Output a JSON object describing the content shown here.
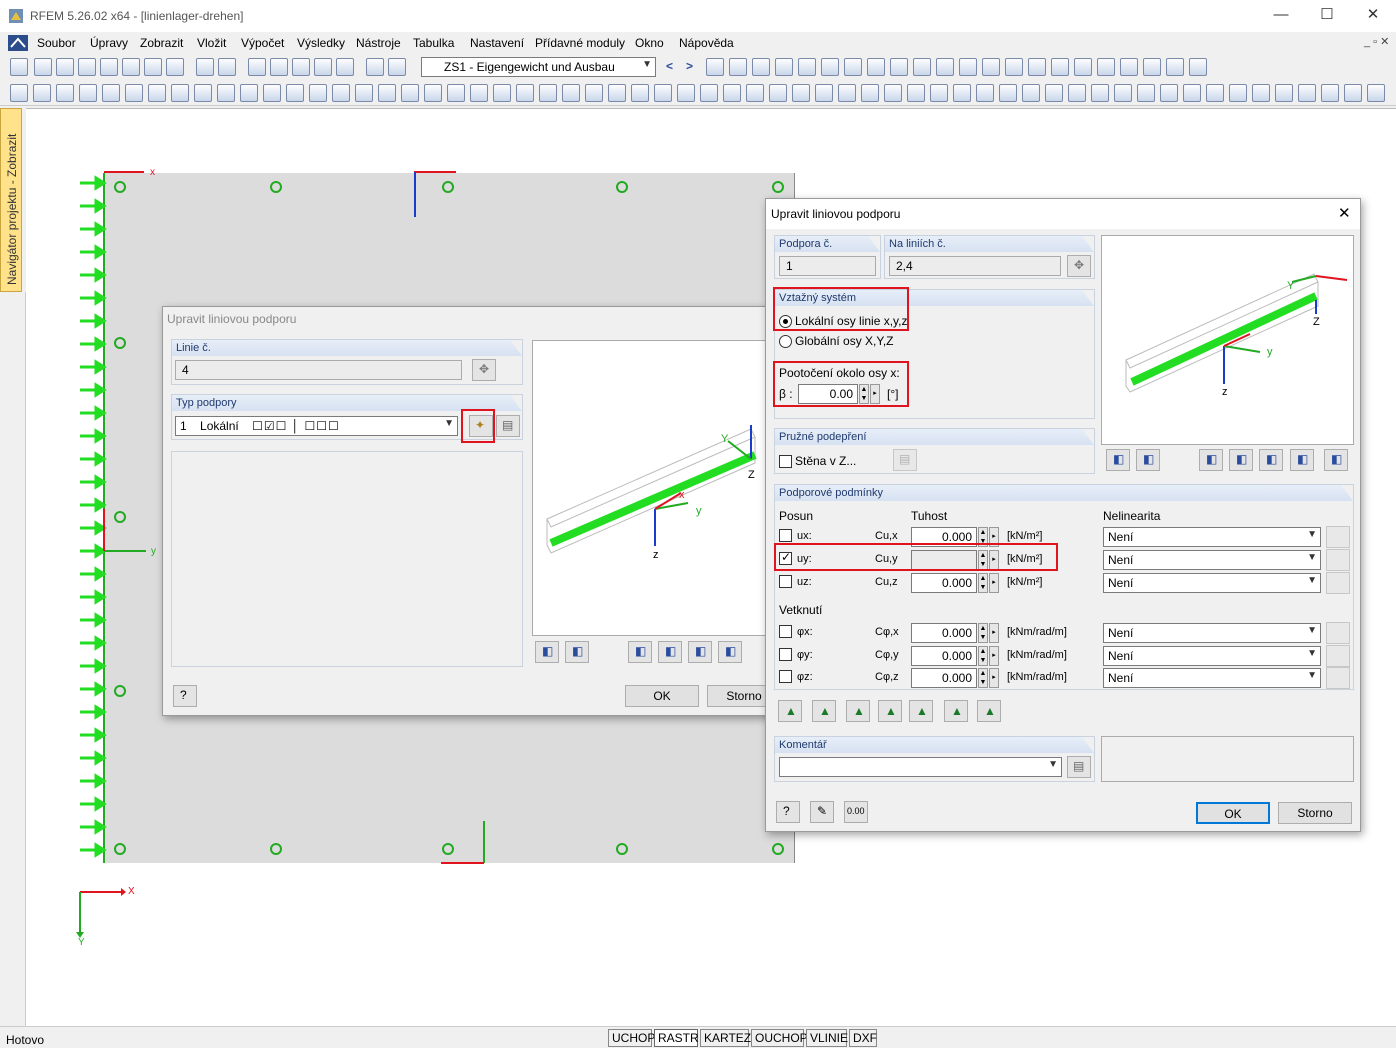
{
  "app": {
    "title": "RFEM 5.26.02 x64 - [linienlager-drehen]",
    "window_min": "—",
    "window_max": "☐",
    "window_close": "✕"
  },
  "menu": [
    "Soubor",
    "Úpravy",
    "Zobrazit",
    "Vložit",
    "Výpočet",
    "Výsledky",
    "Nástroje",
    "Tabulka",
    "Nastavení",
    "Přídavné moduly",
    "Okno",
    "Nápověda"
  ],
  "toolbar": {
    "loadcase": "ZS1 - Eigengewicht und Ausbau",
    "arrow_left": "<",
    "arrow_right": ">"
  },
  "navigator_tab": "Navigátor projektu - Zobrazit",
  "canvas": {
    "axis_x": "X",
    "axis_y": "Y",
    "local_x": "x",
    "local_y": "y"
  },
  "dialog_back": {
    "title": "Upravit liniovou podporu",
    "line_no_label": "Linie č.",
    "line_no_value": "4",
    "support_type_label": "Typ podpory",
    "support_type_no": "1",
    "support_type_name": "Lokální",
    "preview_axis_y": "Y",
    "preview_axis_z": "Z",
    "preview_local_y": "y",
    "preview_local_x": "x",
    "preview_local_z": "z",
    "ok": "OK",
    "cancel": "Storno"
  },
  "dialog_front": {
    "title": "Upravit liniovou podporu",
    "close": "✕",
    "support_no_label": "Podpora č.",
    "support_no_value": "1",
    "on_lines_label": "Na liniích č.",
    "on_lines_value": "2,4",
    "ref_system_label": "Vztažný systém",
    "ref_local": "Lokální osy linie x,y,z",
    "ref_global": "Globální osy X,Y,Z",
    "rotation_label": "Pootočení okolo osy x:",
    "beta_label": "β :",
    "beta_value": "0.00",
    "beta_unit": "[°]",
    "elastic_label": "Pružné podepření",
    "wall_label": "Stěna v Z...",
    "conditions_label": "Podporové podmínky",
    "col_translation": "Posun",
    "col_stiffness": "Tuhost",
    "col_nonlinearity": "Nelinearita",
    "translation_rows": [
      {
        "label": "ux:",
        "stiff_label": "Cu,x",
        "value": "0.000",
        "unit": "[kN/m²]",
        "nonlin": "Není",
        "checked": false
      },
      {
        "label": "uy:",
        "stiff_label": "Cu,y",
        "value": "",
        "unit": "[kN/m²]",
        "nonlin": "Není",
        "checked": true
      },
      {
        "label": "uz:",
        "stiff_label": "Cu,z",
        "value": "0.000",
        "unit": "[kN/m²]",
        "nonlin": "Není",
        "checked": false
      }
    ],
    "rotation_section": "Vetknutí",
    "rotation_rows": [
      {
        "label": "φx:",
        "stiff_label": "Cφ,x",
        "value": "0.000",
        "unit": "[kNm/rad/m]",
        "nonlin": "Není",
        "checked": false
      },
      {
        "label": "φy:",
        "stiff_label": "Cφ,y",
        "value": "0.000",
        "unit": "[kNm/rad/m]",
        "nonlin": "Není",
        "checked": false
      },
      {
        "label": "φz:",
        "stiff_label": "Cφ,z",
        "value": "0.000",
        "unit": "[kNm/rad/m]",
        "nonlin": "Není",
        "checked": false
      }
    ],
    "comment_label": "Komentář",
    "comment_value": "",
    "preview_axis_y": "Y",
    "preview_axis_z": "Z",
    "preview_local_y": "y",
    "preview_local_z": "z",
    "ok": "OK",
    "cancel": "Storno"
  },
  "status": {
    "text": "Hotovo",
    "buttons": [
      "UCHOP",
      "RASTR",
      "KARTEZ",
      "OUCHOP",
      "VLINIE",
      "DXF"
    ],
    "active": "RASTR"
  },
  "colors": {
    "accent_red": "#e0141e",
    "support_green": "#22dd22",
    "axis_blue": "#1a3ccc"
  }
}
